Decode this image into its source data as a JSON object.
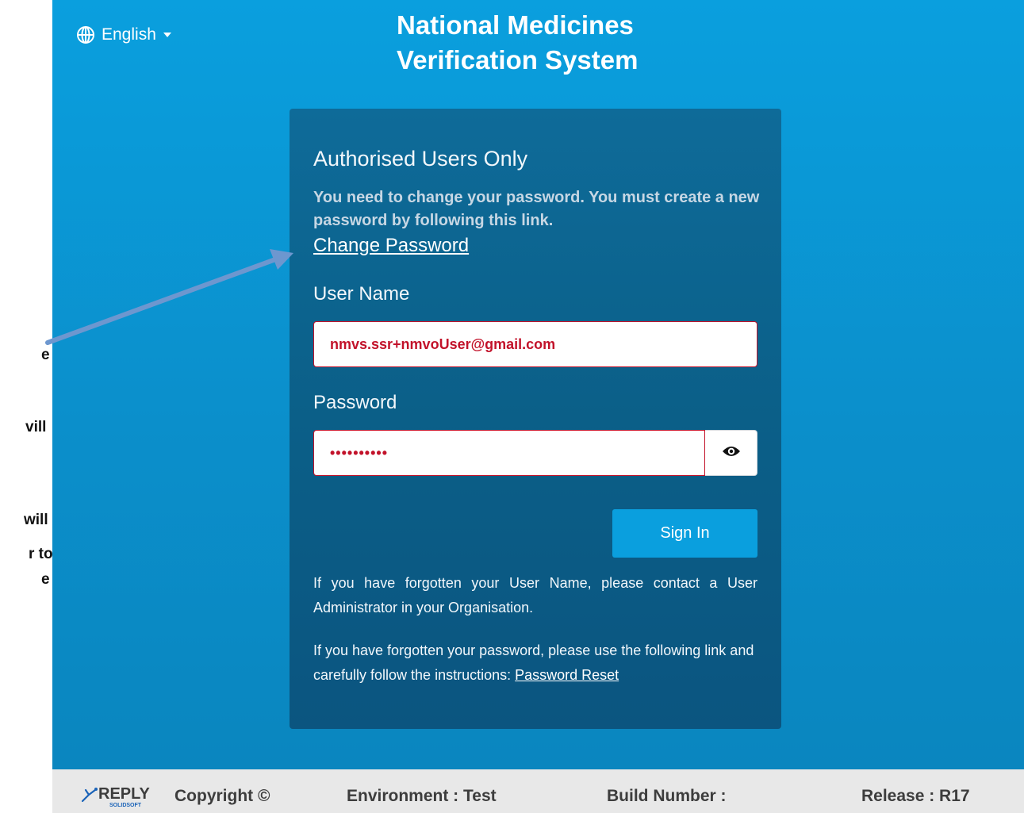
{
  "annotation": {
    "fragments": [
      "e",
      "vill",
      "will",
      "r to",
      "e"
    ]
  },
  "header": {
    "language": "English",
    "title_line1": "National Medicines",
    "title_line2": "Verification System"
  },
  "login": {
    "heading": "Authorised Users Only",
    "notice": "You need to change your password. You must create a new password by following this link.",
    "change_password_link": "Change Password",
    "username_label": "User Name",
    "username_value": "nmvs.ssr+nmvoUser@gmail.com",
    "password_label": "Password",
    "password_masked": "••••••••••",
    "sign_in_label": "Sign In",
    "help_username": "If you have forgotten your User Name, please contact a User Administrator in your Organisation.",
    "help_password_prefix": "If you have forgotten your password, please use the following link and carefully follow the instructions: ",
    "password_reset_link": "Password Reset"
  },
  "footer": {
    "logo_word": "REPLY",
    "logo_sub": "SOLIDSOFT",
    "copyright": "Copyright ©",
    "environment": "Environment : Test",
    "build_number": "Build Number :",
    "release": "Release : R17"
  },
  "colors": {
    "background_top": "#0a9fde",
    "panel": "#0b5f88",
    "accent_button": "#0a9fde",
    "input_error": "#c2122a",
    "footer_bg": "#e8e8e8",
    "annotation_arrow": "#6d97cf"
  },
  "icons": [
    "globe-icon",
    "caret-down-icon",
    "eye-icon",
    "reply-logo-icon",
    "annotation-arrow"
  ]
}
